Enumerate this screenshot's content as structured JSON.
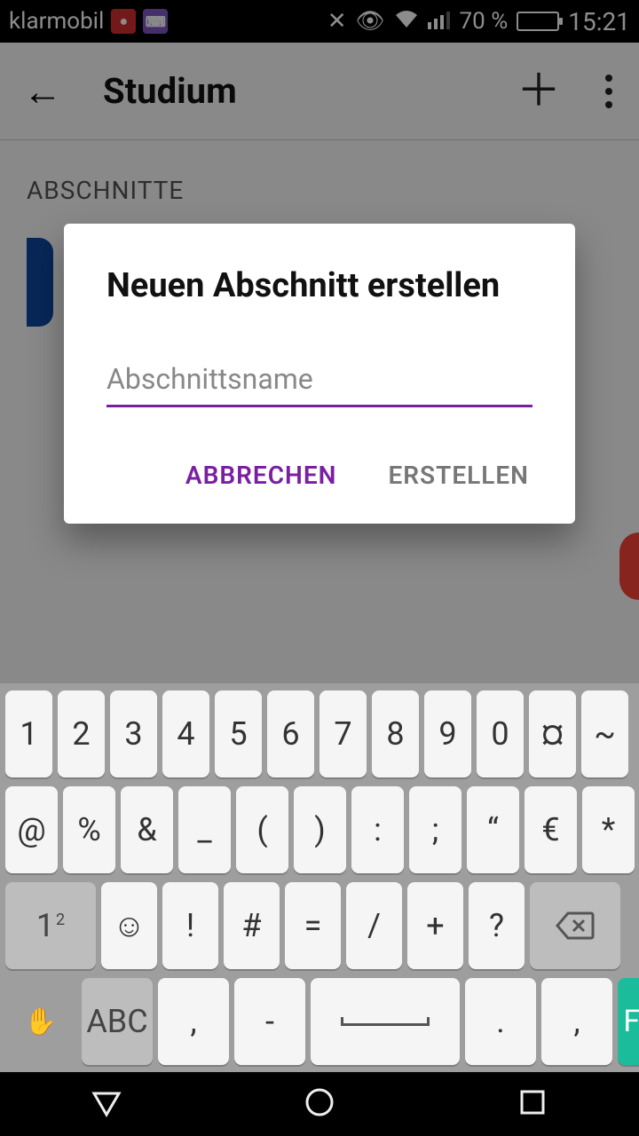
{
  "status": {
    "carrier": "klarmobil",
    "battery_pct": "70 %",
    "time": "15:21"
  },
  "appbar": {
    "title": "Studium"
  },
  "content": {
    "section_header": "ABSCHNITTE"
  },
  "dialog": {
    "title": "Neuen Abschnitt erstellen",
    "placeholder": "Abschnittsname",
    "value": "",
    "cancel": "ABBRECHEN",
    "create": "ERSTELLEN"
  },
  "keyboard": {
    "row1": [
      "1",
      "2",
      "3",
      "4",
      "5",
      "6",
      "7",
      "8",
      "9",
      "0",
      "¤",
      "~"
    ],
    "row2": [
      "@",
      "%",
      "&",
      "_",
      "(",
      ")",
      ":",
      ";",
      "“",
      "€",
      "*"
    ],
    "row3_mode": "1²",
    "row3": [
      "☺",
      "!",
      "#",
      "=",
      "/",
      "+",
      "?"
    ],
    "row4_abc": "ABC",
    "row4": [
      ",",
      "-",
      "␣",
      ".",
      ","
    ],
    "done": "Fertig"
  }
}
